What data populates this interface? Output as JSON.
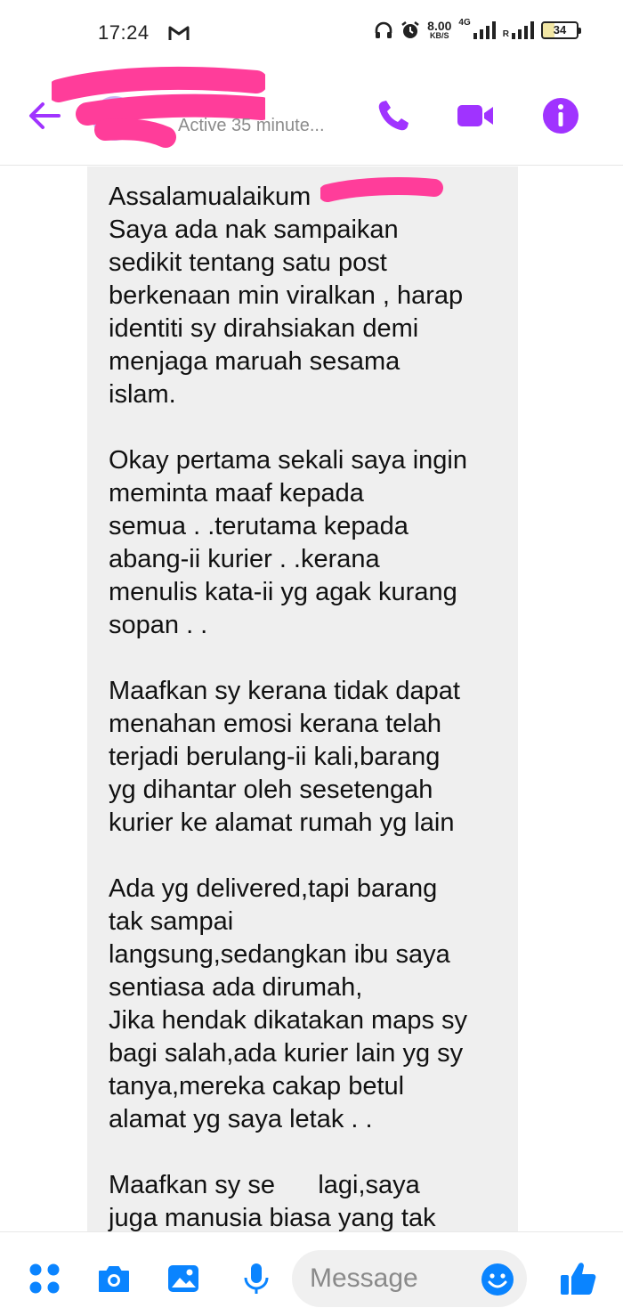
{
  "status_bar": {
    "time": "17:24",
    "net_speed_value": "8.00",
    "net_speed_unit": "KB/S",
    "network_tag": "4G",
    "roaming_tag": "R",
    "battery": "34",
    "icons": [
      "gmail-icon",
      "headphones-icon",
      "alarm-icon",
      "signal-icon",
      "signal-icon",
      "battery-icon"
    ]
  },
  "header": {
    "active_status": "Active 35 minute...",
    "accent_color": "#a033ff",
    "icons": [
      "back-arrow-icon",
      "phone-icon",
      "video-camera-icon",
      "info-icon"
    ]
  },
  "message": {
    "lines": [
      "Assalamualaikum",
      "Saya ada nak sampaikan",
      "sedikit tentang satu post",
      "berkenaan min viralkan , harap",
      "identiti sy dirahsiakan demi",
      "menjaga maruah sesama",
      "islam.",
      "",
      "Okay pertama sekali saya ingin",
      "meminta maaf kepada",
      "semua . .terutama kepada",
      "abang-ii kurier . .kerana",
      "menulis kata-ii yg agak kurang",
      "sopan . .",
      "",
      "Maafkan sy kerana tidak dapat",
      "menahan emosi kerana telah",
      "terjadi berulang-ii kali,barang",
      "yg dihantar oleh sesetengah",
      "kurier ke alamat rumah yg lain",
      "",
      "Ada yg delivered,tapi barang",
      "tak sampai",
      "langsung,sedangkan ibu saya",
      "sentiasa ada dirumah,",
      "Jika hendak dikatakan maps sy",
      "bagi salah,ada kurier lain yg sy",
      "tanya,mereka cakap betul",
      "alamat yg saya letak . .",
      "",
      "Maafkan sy se      lagi,saya",
      "juga manusia biasa yang tak"
    ]
  },
  "composer": {
    "placeholder": "Message",
    "icons": [
      "apps-icon",
      "camera-icon",
      "gallery-icon",
      "microphone-icon",
      "emoji-icon",
      "thumbs-up-icon"
    ]
  },
  "colors": {
    "accent_purple": "#a033ff",
    "accent_blue": "#0a84ff",
    "redaction_pink": "#ff3d9a",
    "bubble_gray": "#efefef"
  }
}
